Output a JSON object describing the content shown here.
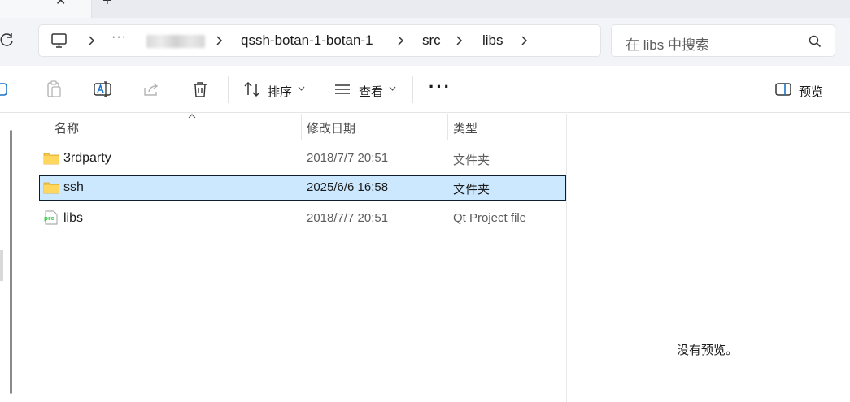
{
  "address": {
    "more_label": "···",
    "crumbs": [
      "qssh-botan-1-botan-1",
      "src",
      "libs"
    ]
  },
  "search": {
    "placeholder": "在 libs 中搜索"
  },
  "toolbar": {
    "sort_label": "排序",
    "view_label": "查看",
    "more_label": "···",
    "preview_label": "预览"
  },
  "columns": {
    "name": "名称",
    "date": "修改日期",
    "type": "类型"
  },
  "files": [
    {
      "name": "3rdparty",
      "date": "2018/7/7 20:51",
      "type": "文件夹",
      "icon": "folder-icon",
      "selected": false
    },
    {
      "name": "ssh",
      "date": "2025/6/6 16:58",
      "type": "文件夹",
      "icon": "folder-icon",
      "selected": true
    },
    {
      "name": "libs",
      "date": "2018/7/7 20:51",
      "type": "Qt Project file",
      "icon": "qt-pro-file-icon",
      "selected": false
    }
  ],
  "preview": {
    "empty_text": "没有预览。"
  },
  "colors": {
    "selection_fill": "#cce8ff",
    "folder": "#f3c447",
    "pro_badge": "#41cd52"
  }
}
